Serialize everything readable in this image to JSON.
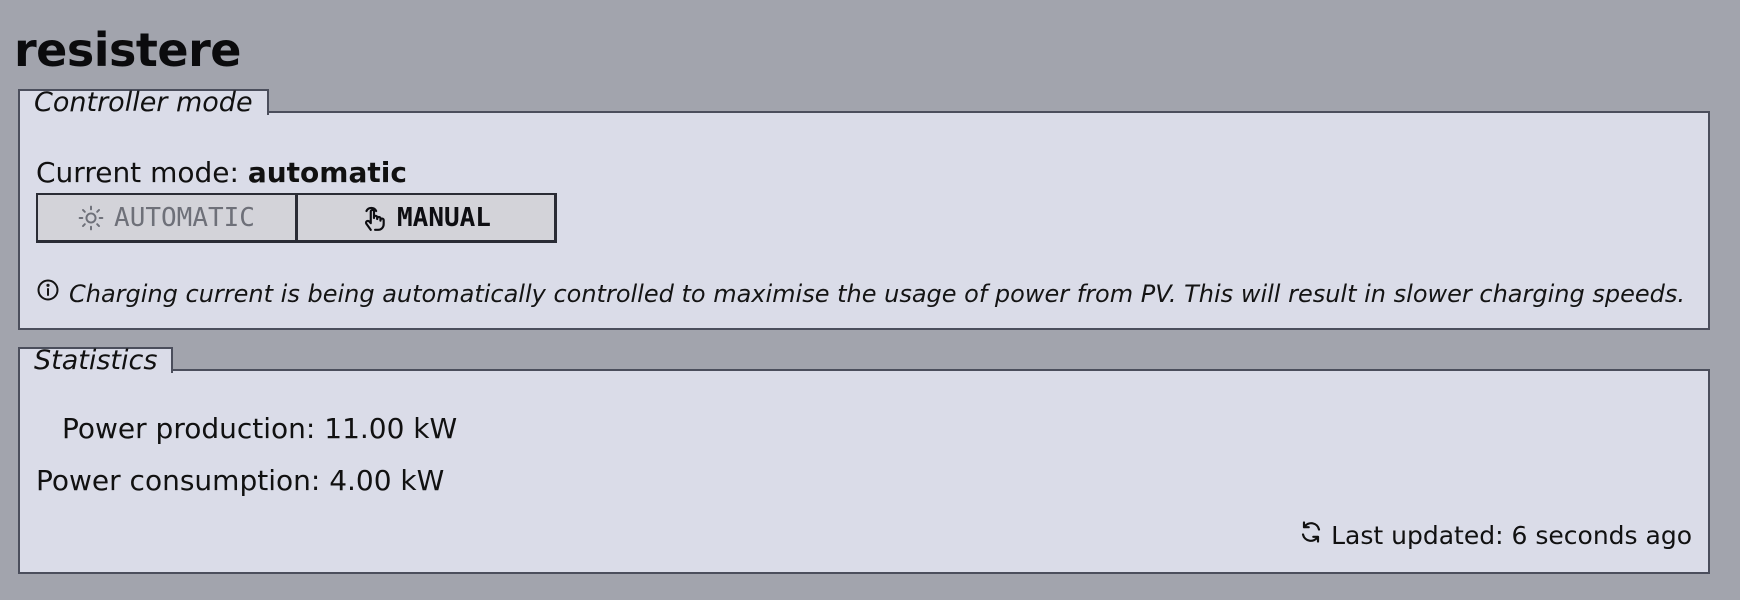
{
  "app": {
    "title": "resistere"
  },
  "controller_mode": {
    "legend": "Controller mode",
    "current_mode_label": "Current mode:",
    "current_mode_value": "automatic",
    "buttons": {
      "automatic": {
        "label": "AUTOMATIC",
        "icon": "sun-icon"
      },
      "manual": {
        "label": "MANUAL",
        "icon": "hand-pointer-icon"
      }
    },
    "info_icon": "info-circle-icon",
    "info_text": "Charging current is being automatically controlled to maximise the usage of power from PV. This will result in slower charging speeds."
  },
  "statistics": {
    "legend": "Statistics",
    "power_production": {
      "label": "Power production:",
      "value": "11.00 kW"
    },
    "power_consumption": {
      "label": "Power consumption:",
      "value": "4.00 kW"
    },
    "last_updated": {
      "icon": "refresh-icon",
      "label": "Last updated:",
      "value": "6 seconds ago"
    }
  },
  "colors": {
    "page_background": "#a2a4ad",
    "panel_background": "#dadce8",
    "panel_border": "#4b4e5c",
    "button_background": "#d3d3d9",
    "disabled_text": "#6e7079"
  }
}
